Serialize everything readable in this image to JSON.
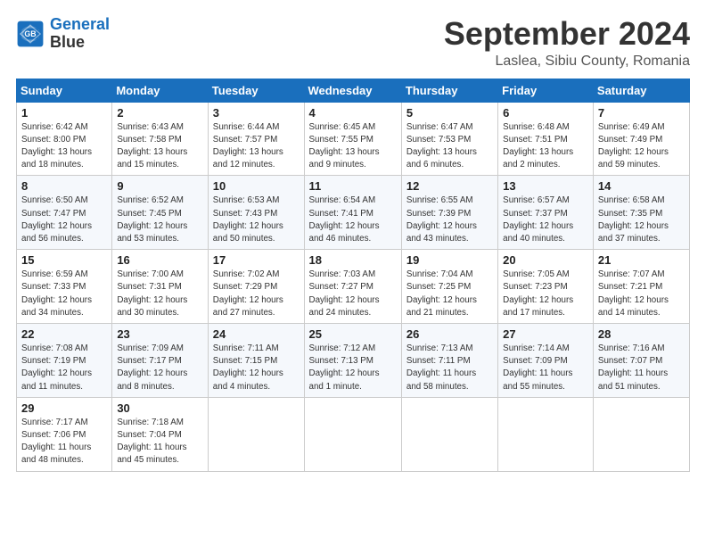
{
  "header": {
    "logo_line1": "General",
    "logo_line2": "Blue",
    "month": "September 2024",
    "location": "Laslea, Sibiu County, Romania"
  },
  "weekdays": [
    "Sunday",
    "Monday",
    "Tuesday",
    "Wednesday",
    "Thursday",
    "Friday",
    "Saturday"
  ],
  "weeks": [
    [
      {
        "day": "1",
        "info": "Sunrise: 6:42 AM\nSunset: 8:00 PM\nDaylight: 13 hours\nand 18 minutes."
      },
      {
        "day": "2",
        "info": "Sunrise: 6:43 AM\nSunset: 7:58 PM\nDaylight: 13 hours\nand 15 minutes."
      },
      {
        "day": "3",
        "info": "Sunrise: 6:44 AM\nSunset: 7:57 PM\nDaylight: 13 hours\nand 12 minutes."
      },
      {
        "day": "4",
        "info": "Sunrise: 6:45 AM\nSunset: 7:55 PM\nDaylight: 13 hours\nand 9 minutes."
      },
      {
        "day": "5",
        "info": "Sunrise: 6:47 AM\nSunset: 7:53 PM\nDaylight: 13 hours\nand 6 minutes."
      },
      {
        "day": "6",
        "info": "Sunrise: 6:48 AM\nSunset: 7:51 PM\nDaylight: 13 hours\nand 2 minutes."
      },
      {
        "day": "7",
        "info": "Sunrise: 6:49 AM\nSunset: 7:49 PM\nDaylight: 12 hours\nand 59 minutes."
      }
    ],
    [
      {
        "day": "8",
        "info": "Sunrise: 6:50 AM\nSunset: 7:47 PM\nDaylight: 12 hours\nand 56 minutes."
      },
      {
        "day": "9",
        "info": "Sunrise: 6:52 AM\nSunset: 7:45 PM\nDaylight: 12 hours\nand 53 minutes."
      },
      {
        "day": "10",
        "info": "Sunrise: 6:53 AM\nSunset: 7:43 PM\nDaylight: 12 hours\nand 50 minutes."
      },
      {
        "day": "11",
        "info": "Sunrise: 6:54 AM\nSunset: 7:41 PM\nDaylight: 12 hours\nand 46 minutes."
      },
      {
        "day": "12",
        "info": "Sunrise: 6:55 AM\nSunset: 7:39 PM\nDaylight: 12 hours\nand 43 minutes."
      },
      {
        "day": "13",
        "info": "Sunrise: 6:57 AM\nSunset: 7:37 PM\nDaylight: 12 hours\nand 40 minutes."
      },
      {
        "day": "14",
        "info": "Sunrise: 6:58 AM\nSunset: 7:35 PM\nDaylight: 12 hours\nand 37 minutes."
      }
    ],
    [
      {
        "day": "15",
        "info": "Sunrise: 6:59 AM\nSunset: 7:33 PM\nDaylight: 12 hours\nand 34 minutes."
      },
      {
        "day": "16",
        "info": "Sunrise: 7:00 AM\nSunset: 7:31 PM\nDaylight: 12 hours\nand 30 minutes."
      },
      {
        "day": "17",
        "info": "Sunrise: 7:02 AM\nSunset: 7:29 PM\nDaylight: 12 hours\nand 27 minutes."
      },
      {
        "day": "18",
        "info": "Sunrise: 7:03 AM\nSunset: 7:27 PM\nDaylight: 12 hours\nand 24 minutes."
      },
      {
        "day": "19",
        "info": "Sunrise: 7:04 AM\nSunset: 7:25 PM\nDaylight: 12 hours\nand 21 minutes."
      },
      {
        "day": "20",
        "info": "Sunrise: 7:05 AM\nSunset: 7:23 PM\nDaylight: 12 hours\nand 17 minutes."
      },
      {
        "day": "21",
        "info": "Sunrise: 7:07 AM\nSunset: 7:21 PM\nDaylight: 12 hours\nand 14 minutes."
      }
    ],
    [
      {
        "day": "22",
        "info": "Sunrise: 7:08 AM\nSunset: 7:19 PM\nDaylight: 12 hours\nand 11 minutes."
      },
      {
        "day": "23",
        "info": "Sunrise: 7:09 AM\nSunset: 7:17 PM\nDaylight: 12 hours\nand 8 minutes."
      },
      {
        "day": "24",
        "info": "Sunrise: 7:11 AM\nSunset: 7:15 PM\nDaylight: 12 hours\nand 4 minutes."
      },
      {
        "day": "25",
        "info": "Sunrise: 7:12 AM\nSunset: 7:13 PM\nDaylight: 12 hours\nand 1 minute."
      },
      {
        "day": "26",
        "info": "Sunrise: 7:13 AM\nSunset: 7:11 PM\nDaylight: 11 hours\nand 58 minutes."
      },
      {
        "day": "27",
        "info": "Sunrise: 7:14 AM\nSunset: 7:09 PM\nDaylight: 11 hours\nand 55 minutes."
      },
      {
        "day": "28",
        "info": "Sunrise: 7:16 AM\nSunset: 7:07 PM\nDaylight: 11 hours\nand 51 minutes."
      }
    ],
    [
      {
        "day": "29",
        "info": "Sunrise: 7:17 AM\nSunset: 7:06 PM\nDaylight: 11 hours\nand 48 minutes."
      },
      {
        "day": "30",
        "info": "Sunrise: 7:18 AM\nSunset: 7:04 PM\nDaylight: 11 hours\nand 45 minutes."
      },
      {
        "day": "",
        "info": ""
      },
      {
        "day": "",
        "info": ""
      },
      {
        "day": "",
        "info": ""
      },
      {
        "day": "",
        "info": ""
      },
      {
        "day": "",
        "info": ""
      }
    ]
  ]
}
